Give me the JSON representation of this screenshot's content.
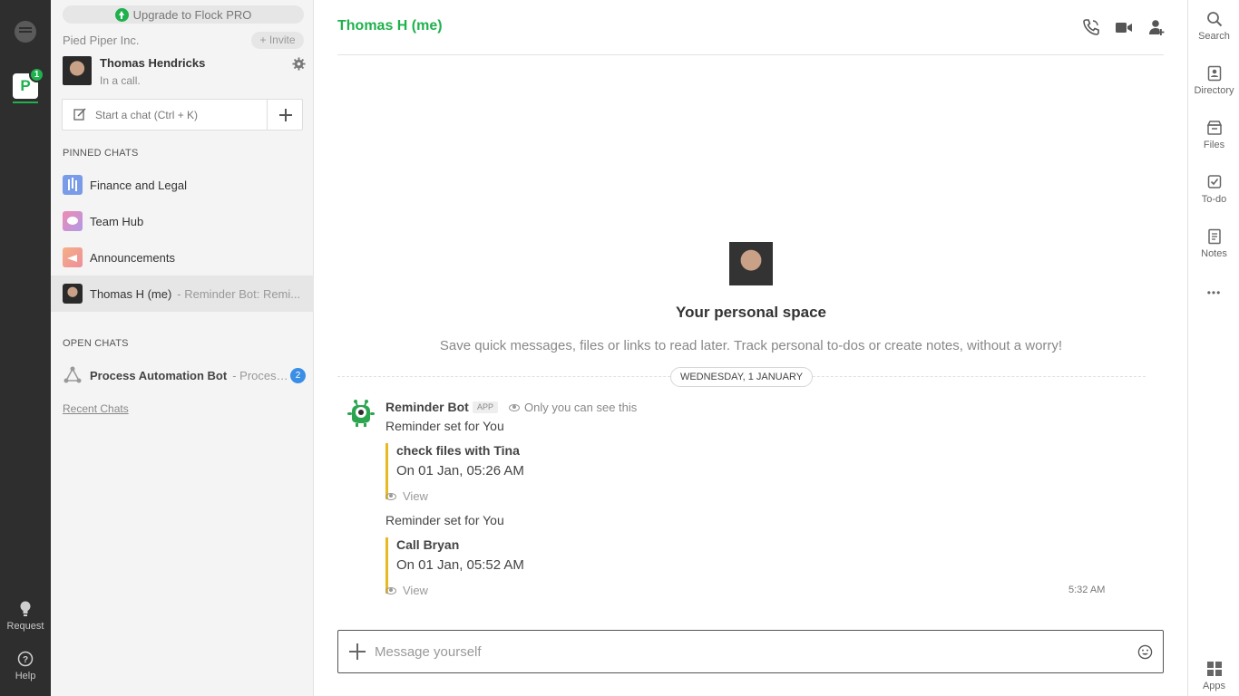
{
  "rail": {
    "team_letter": "P",
    "team_badge": "1",
    "request_label": "Request",
    "help_label": "Help"
  },
  "sidebar": {
    "upgrade_label": "Upgrade to Flock PRO",
    "org_name": "Pied Piper Inc.",
    "invite_label": "+ Invite",
    "user_name": "Thomas Hendricks",
    "user_status": "In a call.",
    "start_chat_placeholder": "Start a chat (Ctrl + K)",
    "pinned_title": "PINNED CHATS",
    "pinned": [
      {
        "name": "Finance and Legal",
        "preview": "",
        "icon": "finance-icon"
      },
      {
        "name": "Team Hub",
        "preview": "",
        "icon": "team-hub-icon"
      },
      {
        "name": "Announcements",
        "preview": "",
        "icon": "announcements-icon"
      },
      {
        "name": "Thomas H (me)",
        "preview": "- Reminder Bot: Remi...",
        "icon": "avatar"
      }
    ],
    "open_title": "OPEN CHATS",
    "open": [
      {
        "name": "Process Automation Bot",
        "preview": "- Process Au",
        "badge": "2",
        "icon": "process-bot-icon"
      }
    ],
    "recent_link": "Recent Chats"
  },
  "header": {
    "title": "Thomas H (me)"
  },
  "personal_space": {
    "title": "Your personal space",
    "subtitle": "Save quick messages, files or links to read later. Track personal to-dos or create notes, without a worry!"
  },
  "date_divider": "WEDNESDAY, 1 JANUARY",
  "message": {
    "sender": "Reminder Bot",
    "tag": "APP",
    "visibility": "Only you can see this",
    "time": "5:32 AM",
    "reminders": [
      {
        "intro": "Reminder set for You",
        "title": "check files with Tina",
        "when": "On 01 Jan, 05:26 AM",
        "action": "View"
      },
      {
        "intro": "Reminder set for You",
        "title": "Call Bryan",
        "when": "On 01 Jan, 05:52 AM",
        "action": "View"
      }
    ]
  },
  "composer": {
    "placeholder": "Message yourself"
  },
  "right_rail": {
    "items": [
      "Search",
      "Directory",
      "Files",
      "To-do",
      "Notes"
    ],
    "more_label": "•••",
    "apps_label": "Apps"
  },
  "colors": {
    "accent": "#1fb14d",
    "rail_bg": "#2e2e2e",
    "reminder_bar": "#e8b923",
    "badge_blue": "#3a8ee6"
  }
}
